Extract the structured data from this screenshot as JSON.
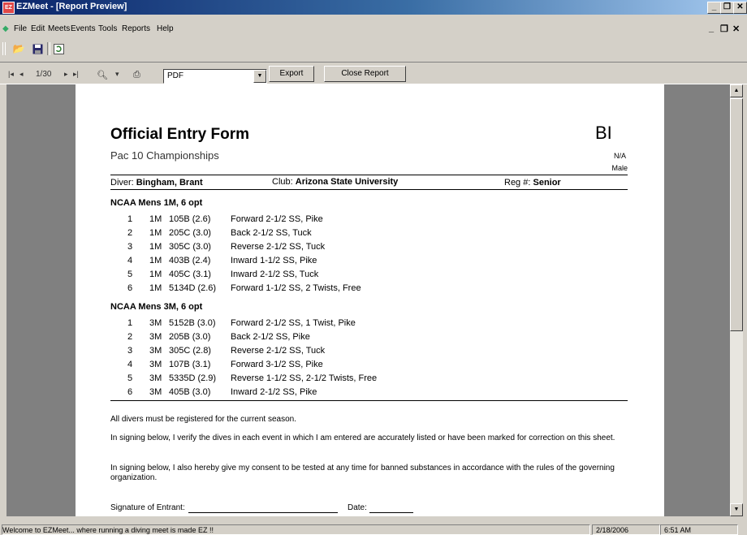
{
  "window": {
    "app_icon_label": "EZ",
    "title": "EZMeet - [Report Preview]",
    "controls": {
      "minimize": "_",
      "restore": "❐",
      "close": "✕"
    }
  },
  "menubar": {
    "items": [
      "File",
      "Edit",
      "Meets",
      "Events",
      "Tools",
      "Reports",
      "Help"
    ],
    "mdi_controls": {
      "minimize": "_",
      "restore": "❐",
      "close": "✕"
    }
  },
  "toolbar": {
    "icons": [
      "open-folder-icon",
      "save-icon",
      "refresh-icon"
    ]
  },
  "report_toolbar": {
    "page_indicator": "1/30",
    "format_value": "PDF",
    "export_label": "Export",
    "close_report_label": "Close Report"
  },
  "report": {
    "title": "Official Entry Form",
    "code": "BI",
    "meet": "Pac 10 Championships",
    "na": "N/A",
    "gender": "Male",
    "diver_label": "Diver:",
    "diver_name": "Bingham, Brant",
    "club_label": "Club:",
    "club_name": "Arizona State University",
    "reg_label": "Reg #:",
    "reg_value": "Senior",
    "events": [
      {
        "name": "NCAA Mens 1M, 6 opt",
        "dives": [
          {
            "n": "1",
            "board": "1M",
            "code": "105B (2.6)",
            "desc": "Forward 2-1/2 SS, Pike"
          },
          {
            "n": "2",
            "board": "1M",
            "code": "205C (3.0)",
            "desc": "Back 2-1/2 SS, Tuck"
          },
          {
            "n": "3",
            "board": "1M",
            "code": "305C (3.0)",
            "desc": "Reverse 2-1/2 SS, Tuck"
          },
          {
            "n": "4",
            "board": "1M",
            "code": "403B (2.4)",
            "desc": "Inward 1-1/2 SS, Pike"
          },
          {
            "n": "5",
            "board": "1M",
            "code": "405C (3.1)",
            "desc": "Inward 2-1/2 SS, Tuck"
          },
          {
            "n": "6",
            "board": "1M",
            "code": "5134D (2.6)",
            "desc": "Forward 1-1/2 SS, 2 Twists, Free"
          }
        ]
      },
      {
        "name": "NCAA Mens 3M, 6 opt",
        "dives": [
          {
            "n": "1",
            "board": "3M",
            "code": "5152B (3.0)",
            "desc": "Forward 2-1/2 SS, 1 Twist, Pike"
          },
          {
            "n": "2",
            "board": "3M",
            "code": "205B (3.0)",
            "desc": "Back 2-1/2 SS, Pike"
          },
          {
            "n": "3",
            "board": "3M",
            "code": "305C (2.8)",
            "desc": "Reverse 2-1/2 SS, Tuck"
          },
          {
            "n": "4",
            "board": "3M",
            "code": "107B (3.1)",
            "desc": "Forward 3-1/2 SS, Pike"
          },
          {
            "n": "5",
            "board": "3M",
            "code": "5335D (2.9)",
            "desc": "Reverse 1-1/2 SS, 2-1/2 Twists, Free"
          },
          {
            "n": "6",
            "board": "3M",
            "code": "405B (3.0)",
            "desc": "Inward 2-1/2 SS, Pike"
          }
        ]
      }
    ],
    "note_registered": "All divers must be registered for the current season.",
    "note_verify": "In signing below, I verify the dives in each event in which I am entered are accurately listed or have been marked for correction on this sheet.",
    "note_consent": "In signing below, I also hereby give my consent to be tested at any time for banned substances in accordance with the rules of the governing organization.",
    "signature_label": "Signature of Entrant:",
    "date_label": "Date:"
  },
  "statusbar": {
    "message": "Welcome to EZMeet... where running a diving meet is made EZ !!",
    "date": "2/18/2006",
    "time": "6:51 AM"
  }
}
